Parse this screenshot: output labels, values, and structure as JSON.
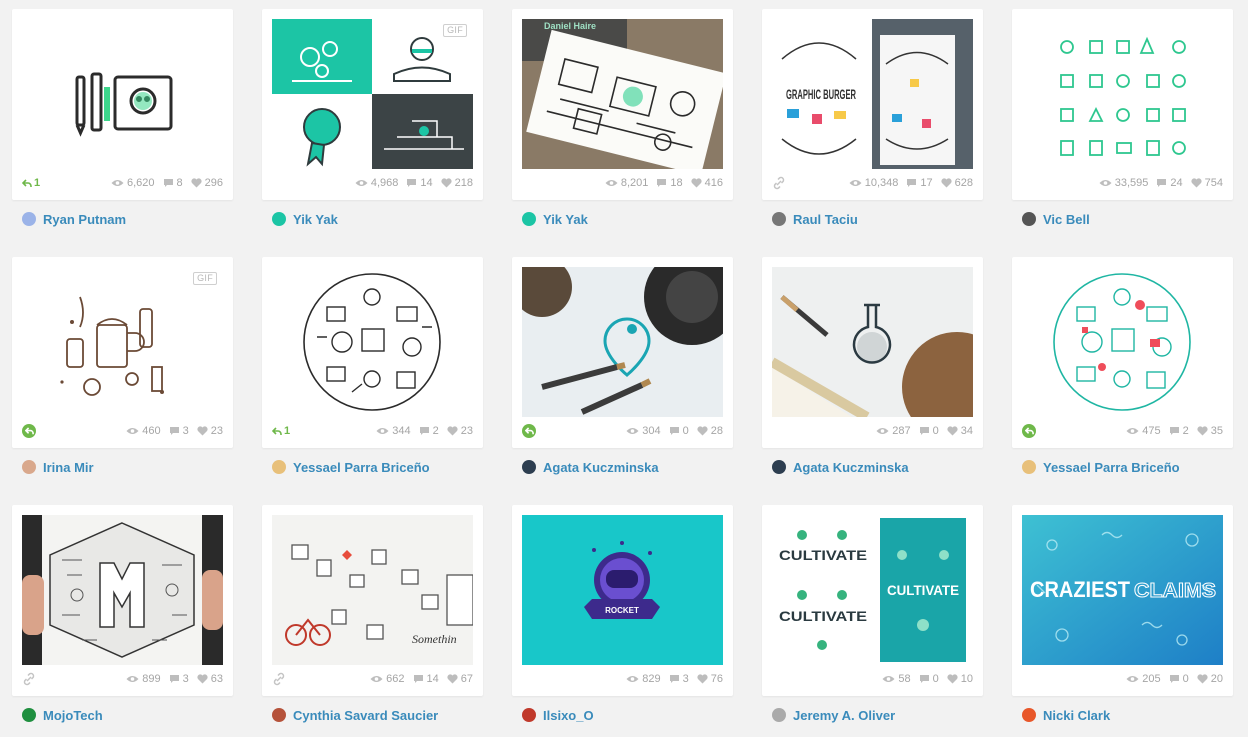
{
  "shots": [
    {
      "author": "Ryan Putnam",
      "views": "6,620",
      "comments": "8",
      "likes": "296",
      "attachment": "rebound-count",
      "rebounds": "1",
      "avatar_color": "#9bb3e8",
      "thumb": "t1"
    },
    {
      "author": "Yik Yak",
      "views": "4,968",
      "comments": "14",
      "likes": "218",
      "attachment": "none",
      "gif": "GIF",
      "avatar_color": "#1cc5a5",
      "thumb": "t2"
    },
    {
      "author": "Yik Yak",
      "views": "8,201",
      "comments": "18",
      "likes": "416",
      "attachment": "none",
      "avatar_color": "#1cc5a5",
      "thumb": "t3",
      "card_heading": "Daniel Haire"
    },
    {
      "author": "Raul Taciu",
      "views": "10,348",
      "comments": "17",
      "likes": "628",
      "attachment": "link",
      "avatar_color": "#777777",
      "thumb": "t4",
      "card_text": "GRAPHIC BURGER"
    },
    {
      "author": "Vic Bell",
      "views": "33,595",
      "comments": "24",
      "likes": "754",
      "attachment": "none",
      "avatar_color": "#555555",
      "thumb": "t5"
    },
    {
      "author": "Irina Mir",
      "views": "460",
      "comments": "3",
      "likes": "23",
      "attachment": "rebound",
      "gif": "GIF",
      "avatar_color": "#d9a88c",
      "thumb": "t6"
    },
    {
      "author": "Yessael Parra Briceño",
      "views": "344",
      "comments": "2",
      "likes": "23",
      "attachment": "rebound-count",
      "rebounds": "1",
      "avatar_color": "#e8c07a",
      "thumb": "t7"
    },
    {
      "author": "Agata Kuczminska",
      "views": "304",
      "comments": "0",
      "likes": "28",
      "attachment": "rebound",
      "avatar_color": "#2d3e50",
      "thumb": "t8"
    },
    {
      "author": "Agata Kuczminska",
      "views": "287",
      "comments": "0",
      "likes": "34",
      "attachment": "none",
      "avatar_color": "#2d3e50",
      "thumb": "t9"
    },
    {
      "author": "Yessael Parra Briceño",
      "views": "475",
      "comments": "2",
      "likes": "35",
      "attachment": "rebound",
      "avatar_color": "#e8c07a",
      "thumb": "t10"
    },
    {
      "author": "MojoTech",
      "views": "899",
      "comments": "3",
      "likes": "63",
      "attachment": "link",
      "avatar_color": "#1f8f3f",
      "thumb": "t11"
    },
    {
      "author": "Cynthia Savard Saucier",
      "views": "662",
      "comments": "14",
      "likes": "67",
      "attachment": "link",
      "avatar_color": "#b5523a",
      "thumb": "t12"
    },
    {
      "author": "Ilsixo_O",
      "views": "829",
      "comments": "3",
      "likes": "76",
      "attachment": "none",
      "avatar_color": "#c0392b",
      "thumb": "t13",
      "card_text": "ROCKET"
    },
    {
      "author": "Jeremy A. Oliver",
      "views": "58",
      "comments": "0",
      "likes": "10",
      "attachment": "none",
      "avatar_color": "#aaaaaa",
      "thumb": "t14",
      "card_text": "CULTIVATE"
    },
    {
      "author": "Nicki Clark",
      "views": "205",
      "comments": "0",
      "likes": "20",
      "attachment": "none",
      "avatar_color": "#e8572a",
      "thumb": "t15",
      "card_text": "CRAZIEST",
      "card_text2": "CLAIMS"
    }
  ],
  "colors": {
    "author_link": "#3a8bbb",
    "rebound_green": "#6fb84a",
    "stat_gray": "#a5a5a5",
    "teal": "#1cc5a5"
  }
}
